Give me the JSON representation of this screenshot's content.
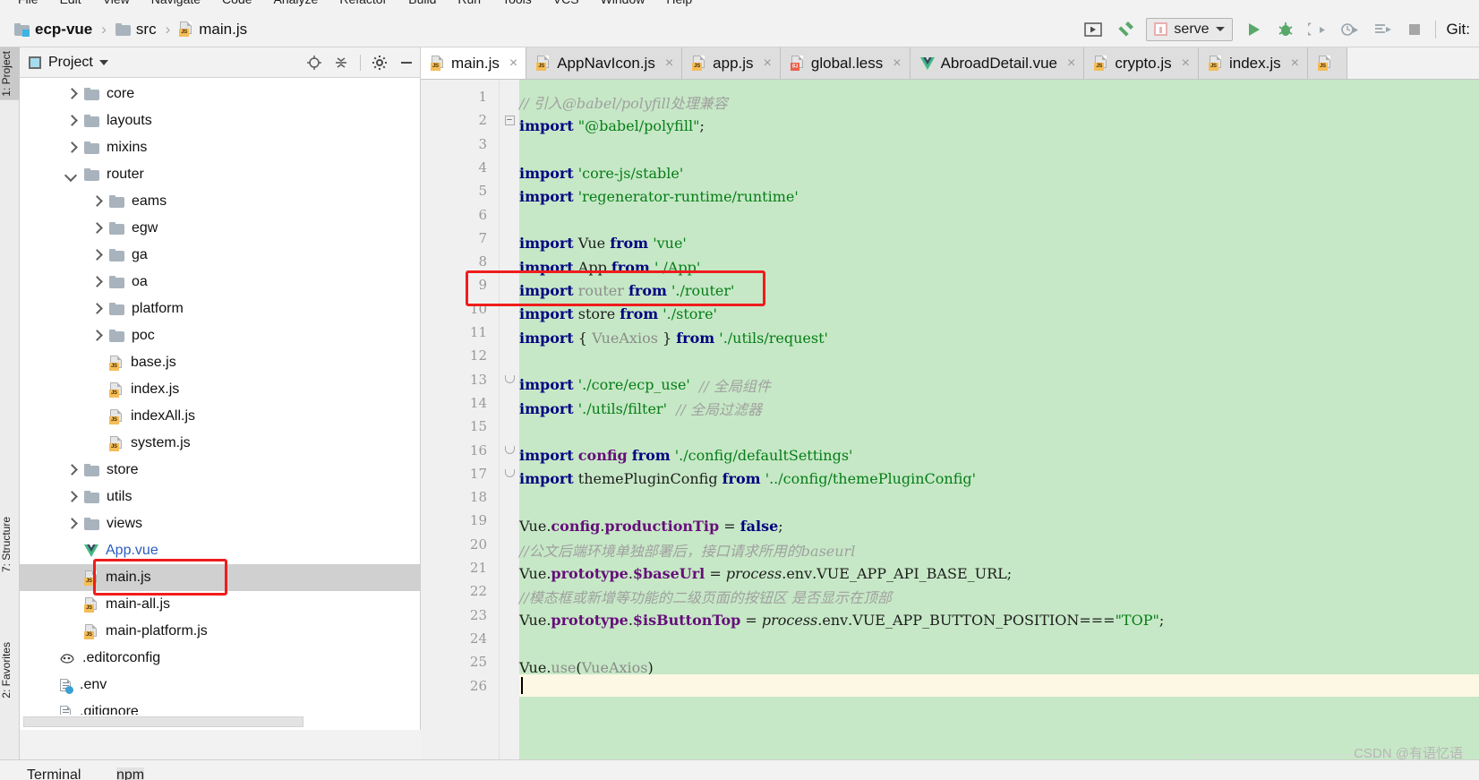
{
  "menu": {
    "items": [
      "File",
      "Edit",
      "View",
      "Navigate",
      "Code",
      "Analyze",
      "Refactor",
      "Build",
      "Run",
      "Tools",
      "VCS",
      "Window",
      "Help"
    ]
  },
  "breadcrumb": {
    "separator": "›",
    "items": [
      {
        "label": "ecp-vue",
        "icon": "folder-module-icon",
        "bold": true
      },
      {
        "label": "src",
        "icon": "folder-icon",
        "bold": false
      },
      {
        "label": "main.js",
        "icon": "js-file-icon",
        "bold": false
      }
    ]
  },
  "toolbar": {
    "buttons": [
      {
        "name": "run-anything-icon",
        "title": "Run Anything"
      },
      {
        "name": "build-hammer-icon",
        "title": "Build Project"
      }
    ],
    "run_config": {
      "label": "serve",
      "icon": "npm-icon",
      "chevron": "chevron-down-icon"
    },
    "run_buttons": [
      {
        "name": "run-icon",
        "title": "Run serve"
      },
      {
        "name": "debug-icon",
        "title": "Debug serve"
      },
      {
        "name": "run-with-coverage-icon",
        "title": "Run with Coverage"
      },
      {
        "name": "profiler-icon",
        "title": "Profiler"
      },
      {
        "name": "run-to-cursor-icon",
        "title": "Run to Cursor"
      },
      {
        "name": "stop-icon",
        "title": "Stop"
      }
    ],
    "git_label": "Git:"
  },
  "left_bar": {
    "tabs": [
      {
        "label": "1: Project",
        "active": true
      },
      {
        "label": "7: Structure",
        "active": false
      },
      {
        "label": "2: Favorites",
        "active": false
      }
    ]
  },
  "project_panel": {
    "title": "Project",
    "caret": "chevron-down-icon",
    "actions": [
      "locate-icon",
      "collapse-all-icon",
      "settings-gear-icon",
      "minimize-icon"
    ],
    "tree": [
      {
        "label": "core",
        "type": "folder",
        "indent": 1,
        "state": "closed"
      },
      {
        "label": "layouts",
        "type": "folder",
        "indent": 1,
        "state": "closed"
      },
      {
        "label": "mixins",
        "type": "folder",
        "indent": 1,
        "state": "closed"
      },
      {
        "label": "router",
        "type": "folder",
        "indent": 1,
        "state": "open"
      },
      {
        "label": "eams",
        "type": "folder",
        "indent": 2,
        "state": "closed"
      },
      {
        "label": "egw",
        "type": "folder",
        "indent": 2,
        "state": "closed"
      },
      {
        "label": "ga",
        "type": "folder",
        "indent": 2,
        "state": "closed"
      },
      {
        "label": "oa",
        "type": "folder",
        "indent": 2,
        "state": "closed"
      },
      {
        "label": "platform",
        "type": "folder",
        "indent": 2,
        "state": "closed"
      },
      {
        "label": "poc",
        "type": "folder",
        "indent": 2,
        "state": "closed"
      },
      {
        "label": "base.js",
        "type": "js",
        "indent": 2,
        "state": "leaf"
      },
      {
        "label": "index.js",
        "type": "js",
        "indent": 2,
        "state": "leaf"
      },
      {
        "label": "indexAll.js",
        "type": "js",
        "indent": 2,
        "state": "leaf"
      },
      {
        "label": "system.js",
        "type": "js",
        "indent": 2,
        "state": "leaf"
      },
      {
        "label": "store",
        "type": "folder",
        "indent": 1,
        "state": "closed"
      },
      {
        "label": "utils",
        "type": "folder",
        "indent": 1,
        "state": "closed"
      },
      {
        "label": "views",
        "type": "folder",
        "indent": 1,
        "state": "closed"
      },
      {
        "label": "App.vue",
        "type": "vue",
        "indent": 1,
        "state": "leaf",
        "opened": true
      },
      {
        "label": "main.js",
        "type": "js",
        "indent": 1,
        "state": "leaf",
        "selected": true
      },
      {
        "label": "main-all.js",
        "type": "js",
        "indent": 1,
        "state": "leaf"
      },
      {
        "label": "main-platform.js",
        "type": "js",
        "indent": 1,
        "state": "leaf"
      },
      {
        "label": ".editorconfig",
        "type": "editorconfig",
        "indent": 0,
        "state": "leaf"
      },
      {
        "label": ".env",
        "type": "env",
        "indent": 0,
        "state": "leaf"
      },
      {
        "label": ".gitignore",
        "type": "text",
        "indent": 0,
        "state": "leaf"
      }
    ]
  },
  "editor": {
    "tabs": [
      {
        "label": "main.js",
        "type": "js",
        "active": true,
        "close": "×"
      },
      {
        "label": "AppNavIcon.js",
        "type": "js",
        "active": false,
        "close": "×"
      },
      {
        "label": "app.js",
        "type": "js",
        "active": false,
        "close": "×"
      },
      {
        "label": "global.less",
        "type": "less",
        "active": false,
        "close": "×"
      },
      {
        "label": "AbroadDetail.vue",
        "type": "vue",
        "active": false,
        "close": "×"
      },
      {
        "label": "crypto.js",
        "type": "js",
        "active": false,
        "close": "×"
      },
      {
        "label": "index.js",
        "type": "js",
        "active": false,
        "close": "×"
      },
      {
        "label": "",
        "type": "js",
        "active": false,
        "close": ""
      }
    ],
    "filename": "main.js",
    "lines": [
      {
        "n": 1,
        "text": "// 引入@babel/polyfill处理兼容"
      },
      {
        "n": 2,
        "text": "import \"@babel/polyfill\";",
        "fold": "minus"
      },
      {
        "n": 3,
        "text": ""
      },
      {
        "n": 4,
        "text": "import 'core-js/stable'"
      },
      {
        "n": 5,
        "text": "import 'regenerator-runtime/runtime'"
      },
      {
        "n": 6,
        "text": ""
      },
      {
        "n": 7,
        "text": "import Vue from 'vue'"
      },
      {
        "n": 8,
        "text": "import App from './App'"
      },
      {
        "n": 9,
        "text": "import router from './router'",
        "annotated": true
      },
      {
        "n": 10,
        "text": "import store from './store'"
      },
      {
        "n": 11,
        "text": "import { VueAxios } from './utils/request'"
      },
      {
        "n": 12,
        "text": ""
      },
      {
        "n": 13,
        "text": "import './core/ecp_use'  // 全局组件",
        "fold": "brace"
      },
      {
        "n": 14,
        "text": "import './utils/filter'  // 全局过滤器"
      },
      {
        "n": 15,
        "text": ""
      },
      {
        "n": 16,
        "text": "import config from './config/defaultSettings'",
        "fold": "brace"
      },
      {
        "n": 17,
        "text": "import themePluginConfig from '../config/themePluginConfig'",
        "fold": "brace"
      },
      {
        "n": 18,
        "text": ""
      },
      {
        "n": 19,
        "text": "Vue.config.productionTip = false;"
      },
      {
        "n": 20,
        "text": "//公文后端环境单独部署后，接口请求所用的baseurl"
      },
      {
        "n": 21,
        "text": "Vue.prototype.$baseUrl = process.env.VUE_APP_API_BASE_URL;"
      },
      {
        "n": 22,
        "text": "//模态框或新增等功能的二级页面的按钮区 是否显示在顶部"
      },
      {
        "n": 23,
        "text": "Vue.prototype.$isButtonTop = process.env.VUE_APP_BUTTON_POSITION===\"TOP\";"
      },
      {
        "n": 24,
        "text": ""
      },
      {
        "n": 25,
        "text": "Vue.use(VueAxios)"
      },
      {
        "n": 26,
        "text": "",
        "current": true
      }
    ]
  },
  "annotations": [
    {
      "name": "highlight-import-router",
      "color": "#f01c1c"
    },
    {
      "name": "highlight-main-js-file",
      "color": "#f01c1c"
    }
  ],
  "colors": {
    "editor_background": "#c6e8c6",
    "current_line": "#fdf8e3",
    "selection": "#d0d0d0",
    "annotation_red": "#f01c1c",
    "keyword": "#000080",
    "string": "#067d17",
    "comment": "#a0a0a0",
    "field": "#660e7a"
  },
  "watermark": {
    "text": "CSDN @有语忆语"
  },
  "bottom_bar": {
    "items": [
      "Terminal",
      "npm"
    ]
  }
}
